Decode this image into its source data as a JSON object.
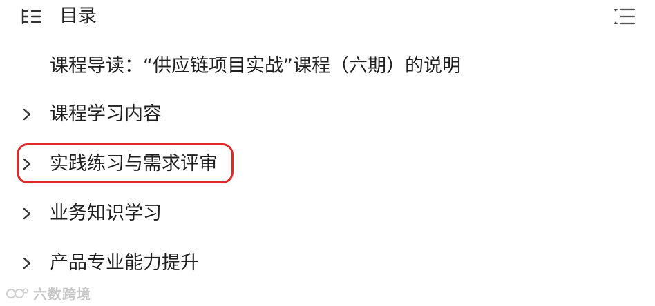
{
  "toc": {
    "title": "目录",
    "items": [
      {
        "label": "课程导读：“供应链项目实战”课程（六期）的说明",
        "expandable": false
      },
      {
        "label": "课程学习内容",
        "expandable": true
      },
      {
        "label": "实践练习与需求评审",
        "expandable": true,
        "highlighted": true
      },
      {
        "label": "业务知识学习",
        "expandable": true
      },
      {
        "label": "产品专业能力提升",
        "expandable": true
      }
    ]
  },
  "colors": {
    "text": "#1f1f1f",
    "icon": "#555555",
    "highlight": "#e02a2a"
  },
  "icons": {
    "toc": "table-of-contents-icon",
    "collapse": "collapse-all-icon",
    "chevron": "chevron-right-icon"
  },
  "watermark": {
    "text": "六数跨境"
  }
}
